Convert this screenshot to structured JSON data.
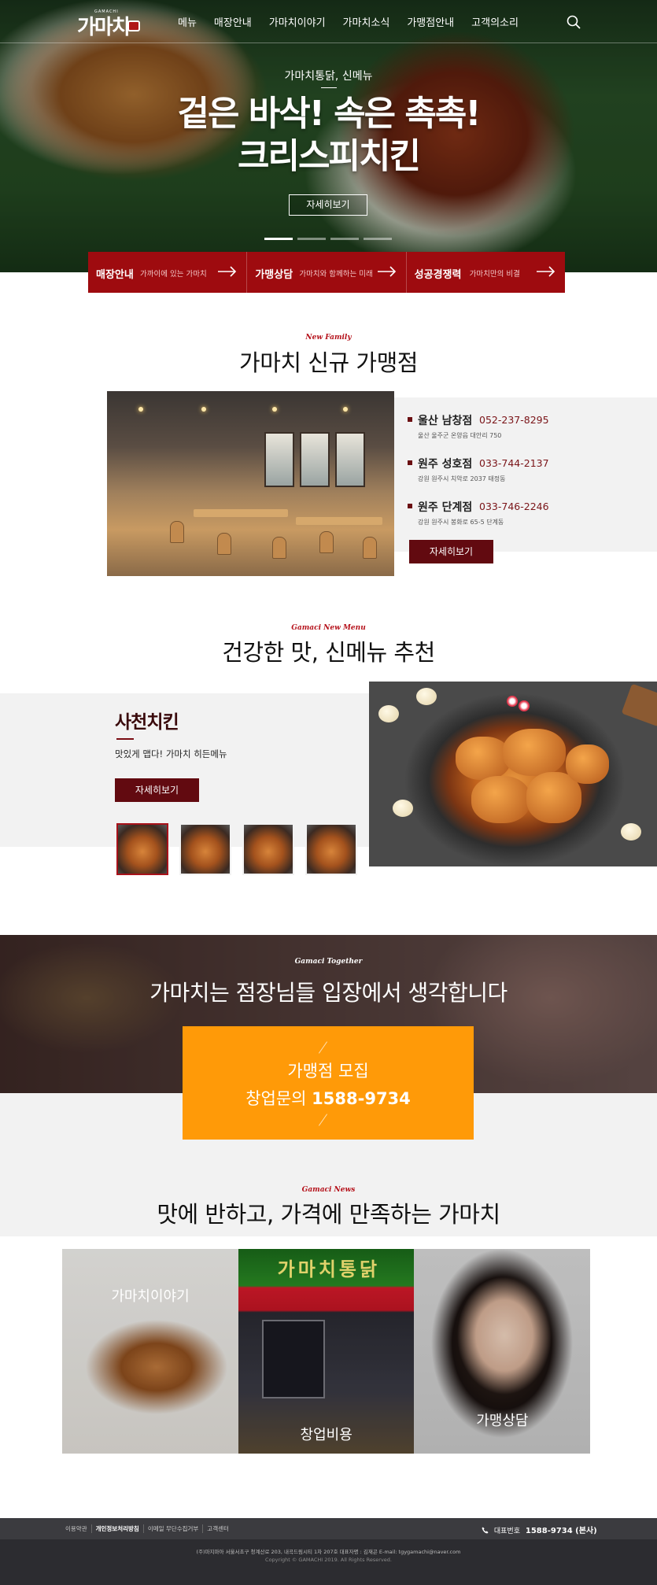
{
  "header": {
    "logo_text": "가마치",
    "logo_sub": "GAMACHI",
    "menu": [
      "메뉴",
      "매장안내",
      "가마치이야기",
      "가마치소식",
      "가맹점안내",
      "고객의소리"
    ]
  },
  "hero": {
    "subtitle": "가마치통닭, 신메뉴",
    "title_line1": "겉은 바삭! 속은 촉촉!",
    "title_line2": "크리스피치킨",
    "button": "자세히보기"
  },
  "quick_links": [
    {
      "title": "매장안내",
      "desc": "가까이에 있는 가마치"
    },
    {
      "title": "가맹상담",
      "desc": "가마치와 함께하는 미래"
    },
    {
      "title": "성공경쟁력",
      "desc": "가마치만의 비결"
    }
  ],
  "new_family": {
    "eyebrow": "New Family",
    "title": "가마치 신규 가맹점",
    "stores": [
      {
        "name": "울산 남창점",
        "phone": "052-237-8295",
        "address": "울산 울주군 온양읍 대안리 750"
      },
      {
        "name": "원주 성호점",
        "phone": "033-744-2137",
        "address": "강원 원주시 치악로 2037 태정동"
      },
      {
        "name": "원주 단계점",
        "phone": "033-746-2246",
        "address": "강원 원주시 봉화로 65-5 단계동"
      }
    ],
    "button": "자세히보기"
  },
  "new_menu": {
    "eyebrow": "Gamaci New Menu",
    "title": "건강한 맛, 신메뉴 추천",
    "name": "사천치킨",
    "desc": "맛있게 맵다! 가마치 히든메뉴",
    "button": "자세히보기"
  },
  "together": {
    "eyebrow": "Gamaci Together",
    "title": "가마치는 점장님들 입장에서 생각합니다",
    "recruit_line1": "가맹점 모집",
    "recruit_prefix": "창업문의",
    "recruit_phone": "1588-9734"
  },
  "news": {
    "eyebrow": "Gamaci News",
    "title": "맛에 반하고, 가격에 만족하는 가마치",
    "cards": [
      "가마치이야기",
      "창업비용",
      "가맹상담"
    ],
    "sign_text": "가마치통닭"
  },
  "footer": {
    "links": [
      "이용약관",
      "개인정보처리방침",
      "이메일 무단수집거부",
      "고객센터"
    ],
    "phone_label": "대표번호",
    "phone": "1588-9734 (본사)",
    "info": "(주)마지마아    서울서초구 청계산로 203, 내곡드림시티 1차 207호    대표자명 : 김재곤    E-mail: tgygamachi@naver.com",
    "copyright": "Copyright © GAMACHI 2019. All Rights Reserved."
  },
  "colors": {
    "brand_red": "#9e0b0f",
    "button_maroon": "#620a10",
    "eyebrow_red": "#b5121b",
    "recruit_orange": "#ff9a08"
  }
}
